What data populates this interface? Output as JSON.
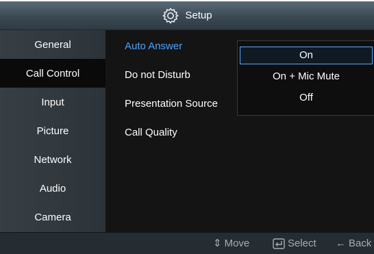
{
  "window": {
    "title": "Setup",
    "title_icon": "gear-icon"
  },
  "sidebar": {
    "items": [
      {
        "label": "General"
      },
      {
        "label": "Call Control",
        "active": true
      },
      {
        "label": "Input"
      },
      {
        "label": "Picture"
      },
      {
        "label": "Network"
      },
      {
        "label": "Audio"
      },
      {
        "label": "Camera"
      }
    ]
  },
  "main": {
    "items": [
      {
        "label": "Auto Answer",
        "highlighted": true
      },
      {
        "label": "Do not Disturb"
      },
      {
        "label": "Presentation Source"
      },
      {
        "label": "Call Quality"
      }
    ]
  },
  "dropdown": {
    "options": [
      {
        "label": "On",
        "selected": true
      },
      {
        "label": "On + Mic Mute"
      },
      {
        "label": "Off"
      }
    ]
  },
  "footer": {
    "move_icon": "updown-arrows-icon",
    "move_glyph": "⇕",
    "move_label": "Move",
    "select_icon": "enter-icon",
    "select_label": "Select",
    "back_icon": "back-arrow-icon",
    "back_glyph": "←",
    "back_label": "Back"
  },
  "colors": {
    "highlight_text": "#4aa3ff",
    "selection_border": "#5aa8ff",
    "background": "#141414",
    "sidebar": "#373f45",
    "titlebar": "#4a5863"
  }
}
